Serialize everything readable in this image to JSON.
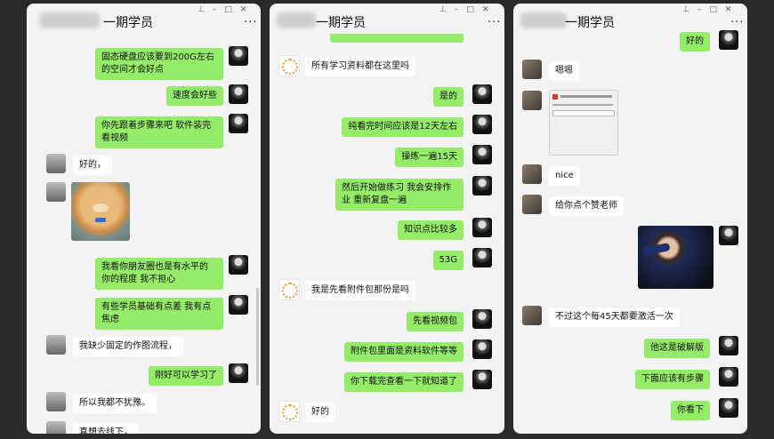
{
  "windows": [
    {
      "title": "一期学员",
      "more": "···",
      "controls": {
        "pin": "⊥",
        "min": "–",
        "max": "□",
        "close": "✕"
      },
      "messages": [
        {
          "text": "固态硬盘应该要到200G左右的空间才会好点",
          "side": "me"
        },
        {
          "text": "速度会好些",
          "side": "me"
        },
        {
          "text": "你先跟着步骤来吧  软件装完  看视频",
          "side": "me"
        },
        {
          "text": "好的，",
          "side": "them"
        },
        {
          "text": "我看你朋友圈也是有水平的  你的程度  我不担心",
          "side": "me"
        },
        {
          "text": "有些学员基础有点差  我有点焦虑",
          "side": "me"
        },
        {
          "text": "我缺少固定的作图流程，",
          "side": "them"
        },
        {
          "text": "刚好可以学习了",
          "side": "me"
        },
        {
          "text": "所以我都不犹豫。",
          "side": "them"
        },
        {
          "text": "真想去线下，",
          "side": "them"
        }
      ],
      "sticker_name": "bear-sticker"
    },
    {
      "title": "一期学员",
      "more": "···",
      "controls": {
        "pin": "⊥",
        "min": "–",
        "max": "□",
        "close": "✕"
      },
      "messages": [
        {
          "text": "所有学习资料都在这里吗",
          "side": "them"
        },
        {
          "text": "是的",
          "side": "me"
        },
        {
          "text": "纯看完时间应该是12天左右",
          "side": "me"
        },
        {
          "text": "操练一遍15天",
          "side": "me"
        },
        {
          "text": "然后开始做练习  我会安排作业  重新复盘一遍",
          "side": "me"
        },
        {
          "text": "知识点比较多",
          "side": "me"
        },
        {
          "text": "53G",
          "side": "me"
        },
        {
          "text": "我是先看附件包那份是吗",
          "side": "them"
        },
        {
          "text": "先看视频包",
          "side": "me"
        },
        {
          "text": "附件包里面是资料软件等等",
          "side": "me"
        },
        {
          "text": "你下载完查看一下就知道了",
          "side": "me"
        },
        {
          "text": "好的",
          "side": "them"
        }
      ]
    },
    {
      "title": "一期学员",
      "more": "···",
      "controls": {
        "pin": "⊥",
        "min": "–",
        "max": "□",
        "close": "✕"
      },
      "messages": [
        {
          "text": "好的",
          "side": "me"
        },
        {
          "text": "嗯嗯",
          "side": "them"
        },
        {
          "text": "nice",
          "side": "them"
        },
        {
          "text": "给你点个赞老师",
          "side": "them"
        },
        {
          "text": "不过这个每45天都要激活一次",
          "side": "them"
        },
        {
          "text": "他这是破解版",
          "side": "me"
        },
        {
          "text": "下面应该有步骤",
          "side": "me"
        },
        {
          "text": "你看下",
          "side": "me"
        }
      ],
      "screenshot_name": "activation-dialog-screenshot",
      "photo_name": "pointing-man-photo"
    }
  ]
}
